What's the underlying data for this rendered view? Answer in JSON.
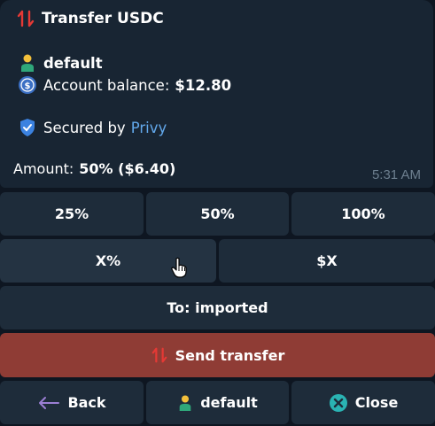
{
  "message": {
    "title": "Transfer USDC",
    "wallet_name": "default",
    "balance_label": "Account balance:",
    "balance_value": "$12.80",
    "secured_prefix": "Secured by",
    "secured_provider": "Privy",
    "amount_label": "Amount:",
    "amount_value": "50% ($6.40)",
    "time": "5:31 AM"
  },
  "keyboard": {
    "pct_25": "25%",
    "pct_50": "50%",
    "pct_100": "100%",
    "custom_pct": "X%",
    "custom_usd": "$X",
    "recipient": "To: imported",
    "send": "Send transfer",
    "back": "Back",
    "wallet": "default",
    "close": "Close"
  },
  "colors": {
    "accent_link": "#62a8eb",
    "send_button": "#8f3c35",
    "transfer_icon": "#e53935",
    "close_icon": "#2ab3b3",
    "back_arrow": "#9b7fd4"
  }
}
